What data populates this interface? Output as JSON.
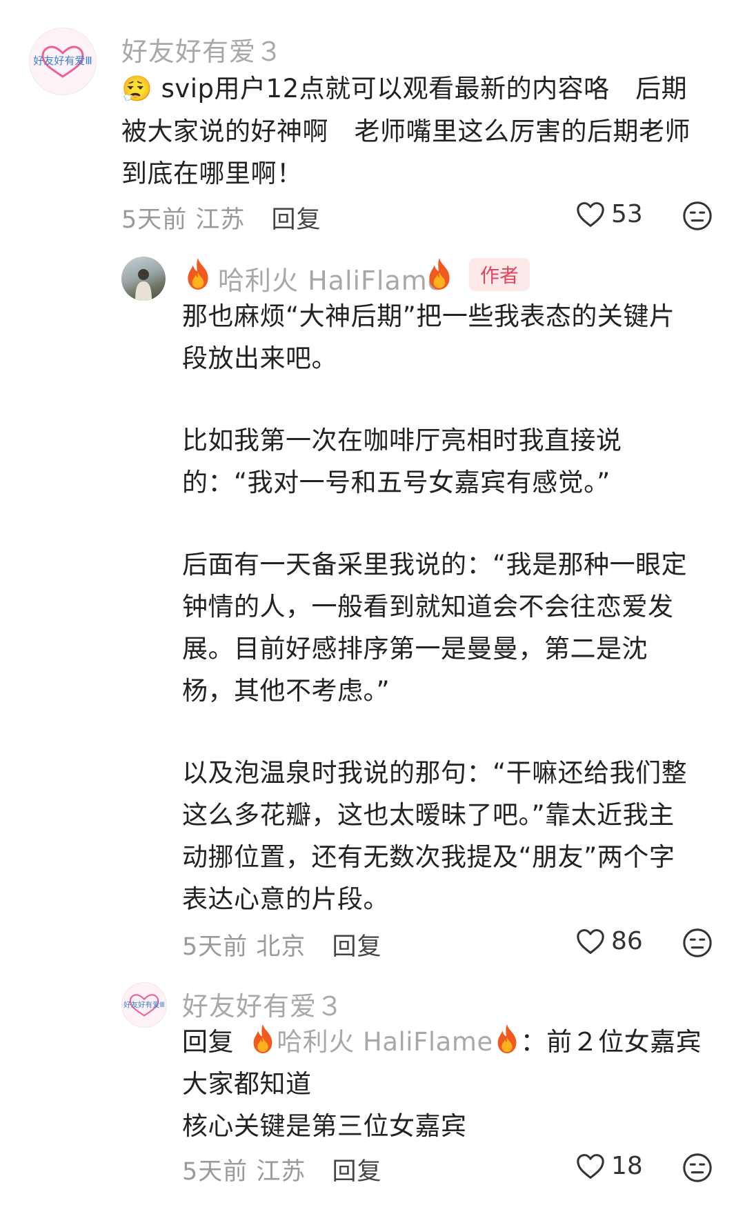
{
  "comments": [
    {
      "username": "好友好有爱３",
      "emoji": "😮‍💨",
      "text": "svip用户12点就可以观看最新的内容咯　后期被大家说的好神啊　老师嘴里这么厉害的后期老师到底在哪里啊！",
      "time_location": "5天前 江苏",
      "reply_label": "回复",
      "likes": "53",
      "avatar_text": "好友好有爱Ⅲ"
    },
    {
      "username": "哈利火 HaliFlame",
      "author_tag": "作者",
      "paragraphs": [
        "那也麻烦“大神后期”把一些我表态的关键片段放出来吧。",
        "比如我第一次在咖啡厅亮相时我直接说的：“我对一号和五号女嘉宾有感觉。”",
        "后面有一天备采里我说的：“我是那种一眼定钟情的人，一般看到就知道会不会往恋爱发展。目前好感排序第一是曼曼，第二是沈杨，其他不考虑。”",
        "以及泡温泉时我说的那句：“干嘛还给我们整这么多花瓣，这也太暧昧了吧。”靠太近我主动挪位置，还有无数次我提及“朋友”两个字表达心意的片段。"
      ],
      "time_location": "5天前 北京",
      "reply_label": "回复",
      "likes": "86"
    },
    {
      "username": "好友好有爱３",
      "reply_prefix": "回复",
      "reply_to": "哈利火 HaliFlame",
      "reply_suffix": "：前２位女嘉宾",
      "lines": [
        "大家都知道",
        "核心关键是第三位女嘉宾"
      ],
      "time_location": "5天前 江苏",
      "reply_label": "回复",
      "likes": "18",
      "avatar_text": "好友好有爱Ⅲ"
    }
  ],
  "colors": {
    "text": "#222222",
    "muted": "#a8a8a8",
    "author_tag_bg": "#fde8ea",
    "author_tag_fg": "#e2455b"
  }
}
